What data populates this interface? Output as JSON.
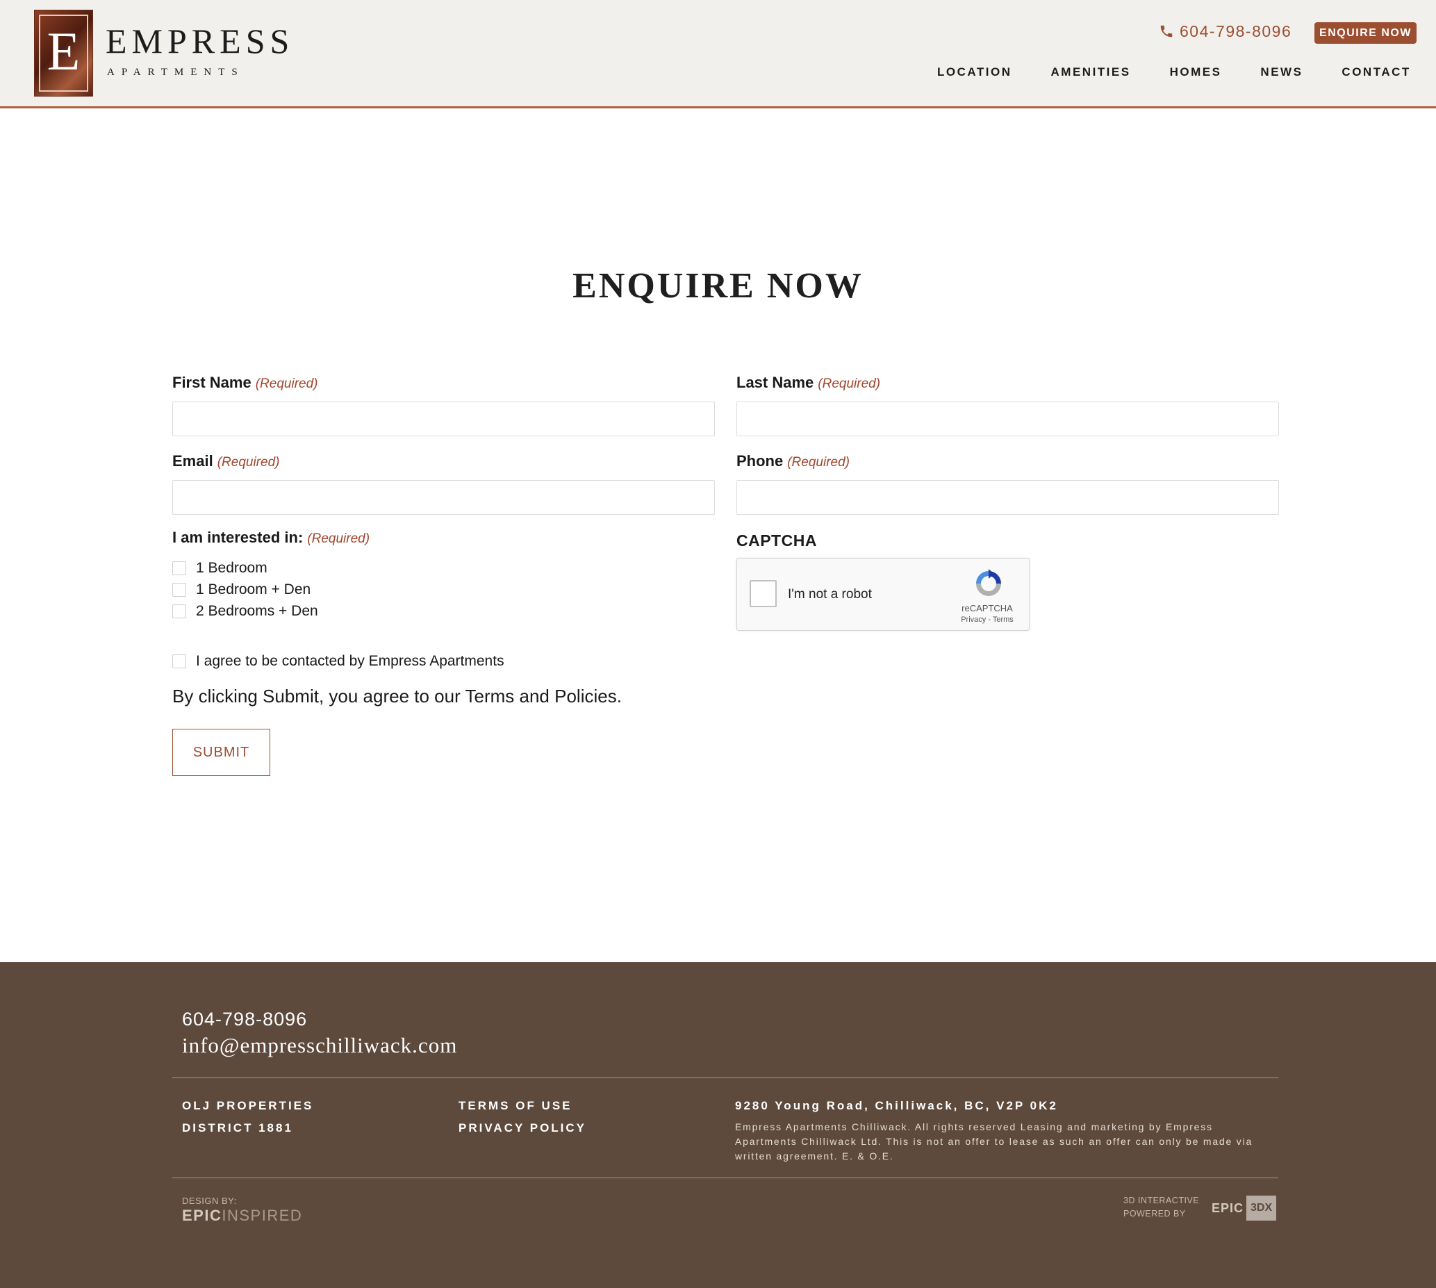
{
  "header": {
    "logo_letter": "E",
    "brand_name": "EMPRESS",
    "brand_sub": "APARTMENTS",
    "phone": "604-798-8096",
    "enquire_label": "ENQUIRE NOW",
    "nav": [
      "LOCATION",
      "AMENITIES",
      "HOMES",
      "NEWS",
      "CONTACT"
    ]
  },
  "main": {
    "title": "ENQUIRE NOW",
    "required_marker": "(Required)",
    "fields": {
      "first_name": {
        "label": "First Name",
        "value": ""
      },
      "last_name": {
        "label": "Last Name",
        "value": ""
      },
      "email": {
        "label": "Email",
        "value": ""
      },
      "phone": {
        "label": "Phone",
        "value": ""
      }
    },
    "interest": {
      "label": "I am interested in:",
      "options": [
        "1 Bedroom",
        "1 Bedroom + Den",
        "2 Bedrooms + Den"
      ]
    },
    "consent_label": "I agree to be contacted by Empress Apartments",
    "agree_text": "By clicking Submit, you agree to our Terms and Policies.",
    "submit_label": "SUBMIT",
    "captcha": {
      "label": "CAPTCHA",
      "checkbox_text": "I'm not a robot",
      "brand": "reCAPTCHA",
      "links": "Privacy - Terms"
    }
  },
  "footer": {
    "phone": "604-798-8096",
    "email": "info@empresschilliwack.com",
    "col1": [
      "OLJ PROPERTIES",
      "DISTRICT 1881"
    ],
    "col2": [
      "TERMS OF USE",
      "PRIVACY POLICY"
    ],
    "address": "9280 Young Road, Chilliwack, BC, V2P 0K2",
    "legal": "Empress Apartments Chilliwack. All rights reserved Leasing and marketing by Empress Apartments Chilliwack Ltd. This is not an offer to lease as such an offer can only be made via written agreement. E. & O.E.",
    "design_by": "DESIGN BY:",
    "design_brand_bold": "EPIC",
    "design_brand_light": "INSPIRED",
    "powered_line1": "3D INTERACTIVE",
    "powered_line2": "POWERED BY",
    "epic3dx_text": "EPIC",
    "epic3dx_badge": "3DX"
  },
  "colors": {
    "accent": "#9c4e31",
    "required": "#a2452c",
    "header_bg": "#f2f0ec",
    "footer_bg": "#5d4a3d"
  }
}
